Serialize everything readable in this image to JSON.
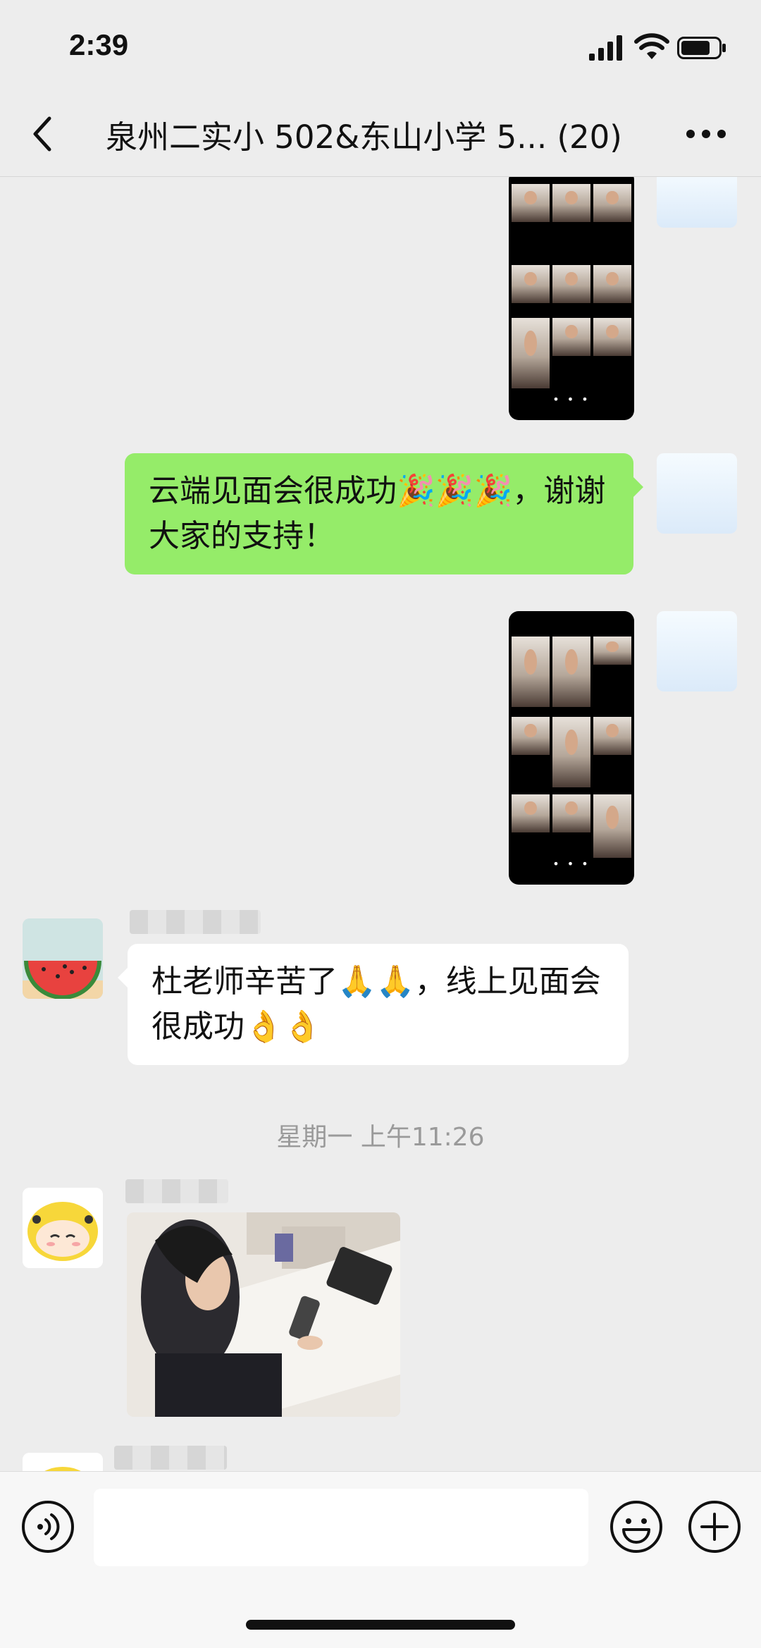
{
  "status": {
    "time": "2:39"
  },
  "header": {
    "title": "泉州二实小 502&东山小学 5... (20)"
  },
  "messages": {
    "sent_text": "云端见面会很成功🎉🎉🎉，谢谢大家的支持！",
    "recv_text": "杜老师辛苦了🙏🙏，线上见面会很成功👌👌",
    "timestamp": "星期一 上午11:26"
  },
  "icons": {
    "back": "chevron-left-icon",
    "more": "ellipsis-icon",
    "voice": "voice-icon",
    "emoji": "smiley-icon",
    "plus": "plus-circle-icon"
  },
  "colors": {
    "sent_bubble": "#95ec69",
    "recv_bubble": "#ffffff",
    "background": "#ededed"
  }
}
